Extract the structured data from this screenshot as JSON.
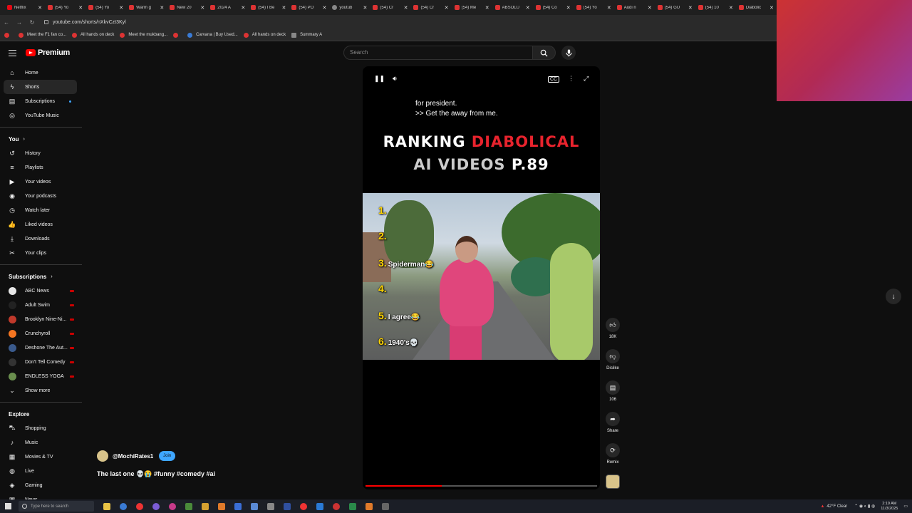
{
  "browser": {
    "tabs": [
      {
        "label": "Netflix",
        "fav": "n"
      },
      {
        "label": "(54) Yo",
        "fav": "r"
      },
      {
        "label": "(54) Yo",
        "fav": "r"
      },
      {
        "label": "Warm g",
        "fav": "r"
      },
      {
        "label": "New 20",
        "fav": "r"
      },
      {
        "label": "2024 A",
        "fav": "r"
      },
      {
        "label": "(54) I Be",
        "fav": "r"
      },
      {
        "label": "(54) PO",
        "fav": "r"
      },
      {
        "label": "youtub",
        "fav": "g"
      },
      {
        "label": "(54) Cr",
        "fav": "r"
      },
      {
        "label": "(54) Cr",
        "fav": "r"
      },
      {
        "label": "(54) Me",
        "fav": "r"
      },
      {
        "label": "ABSOLU",
        "fav": "r"
      },
      {
        "label": "(54) Co",
        "fav": "r"
      },
      {
        "label": "(54) Yo",
        "fav": "r"
      },
      {
        "label": "Audi n",
        "fav": "r"
      },
      {
        "label": "(54) GU",
        "fav": "r"
      },
      {
        "label": "(54) 10",
        "fav": "r"
      },
      {
        "label": "Diabolic",
        "fav": "r"
      }
    ],
    "url": "youtube.com/shorts/nXkvCzt3Kyl",
    "bookmarks": [
      {
        "label": "",
        "icon": "youtube-icon"
      },
      {
        "label": "Meet the F1 fan co...",
        "icon": "youtube-icon"
      },
      {
        "label": "All hands on deck",
        "icon": "youtube-icon"
      },
      {
        "label": "Meet the mukbang...",
        "icon": "youtube-icon"
      },
      {
        "label": "",
        "icon": "youtube-icon"
      },
      {
        "label": "Carvana | Buy Used...",
        "icon": "carvana-icon"
      },
      {
        "label": "All hands on deck",
        "icon": "youtube-icon"
      },
      {
        "label": "Summary A",
        "icon": "summary-icon"
      }
    ]
  },
  "header": {
    "logo_text": "Premium",
    "search_placeholder": "Search"
  },
  "sidebar": {
    "main": [
      {
        "label": "Home",
        "icon": "⌂",
        "name": "home"
      },
      {
        "label": "Shorts",
        "icon": "ϟ",
        "name": "shorts",
        "active": true
      },
      {
        "label": "Subscriptions",
        "icon": "▤",
        "name": "subscriptions",
        "dot": true
      },
      {
        "label": "YouTube Music",
        "icon": "◎",
        "name": "youtube-music"
      }
    ],
    "you_heading": "You",
    "you": [
      {
        "label": "History",
        "icon": "↺",
        "name": "history"
      },
      {
        "label": "Playlists",
        "icon": "≡",
        "name": "playlists"
      },
      {
        "label": "Your videos",
        "icon": "▶",
        "name": "your-videos"
      },
      {
        "label": "Your podcasts",
        "icon": "◉",
        "name": "your-podcasts"
      },
      {
        "label": "Watch later",
        "icon": "◷",
        "name": "watch-later"
      },
      {
        "label": "Liked videos",
        "icon": "👍",
        "name": "liked-videos"
      },
      {
        "label": "Downloads",
        "icon": "⤓",
        "name": "downloads"
      },
      {
        "label": "Your clips",
        "icon": "✂",
        "name": "your-clips"
      }
    ],
    "subs_heading": "Subscriptions",
    "subs": [
      {
        "label": "ABC News",
        "color": "#e6e6e6"
      },
      {
        "label": "Adult Swim",
        "color": "#222222"
      },
      {
        "label": "Brooklyn Nine-Ni...",
        "color": "#c0392b"
      },
      {
        "label": "Crunchyroll",
        "color": "#f47521"
      },
      {
        "label": "Deshone The Aut...",
        "color": "#3a5a8c"
      },
      {
        "label": "Don't Tell Comedy",
        "color": "#333333"
      },
      {
        "label": "ENDLESS YOGA",
        "color": "#6a8f4e"
      }
    ],
    "show_more": "Show more",
    "explore_heading": "Explore",
    "explore": [
      {
        "label": "Shopping",
        "icon": "⛍",
        "name": "shopping"
      },
      {
        "label": "Music",
        "icon": "♪",
        "name": "music"
      },
      {
        "label": "Movies & TV",
        "icon": "▦",
        "name": "movies-tv"
      },
      {
        "label": "Live",
        "icon": "◍",
        "name": "live"
      },
      {
        "label": "Gaming",
        "icon": "◈",
        "name": "gaming"
      },
      {
        "label": "News",
        "icon": "▣",
        "name": "news"
      }
    ]
  },
  "player": {
    "caption_line1": "for president.",
    "caption_line2": ">> Get the away from me.",
    "title_white1": "RANKING ",
    "title_red": "DIABOLICAL",
    "title_grey": "AI VIDEOS ",
    "title_white2": "P.89",
    "rankings": [
      {
        "num": "1.",
        "text": ""
      },
      {
        "num": "2.",
        "text": ""
      },
      {
        "num": "3.",
        "text": "Spiderman😂"
      },
      {
        "num": "4.",
        "text": ""
      },
      {
        "num": "5.",
        "text": "I agree😂"
      },
      {
        "num": "6.",
        "text": "1940's💀"
      }
    ],
    "progress_fraction": 0.33
  },
  "actions": {
    "likes": "18K",
    "dislike": "Dislike",
    "comments": "106",
    "share": "Share",
    "remix": "Remix"
  },
  "channel": {
    "handle": "@MochiRates1",
    "join": "Join",
    "video_title": "The last one 💀😭 #funny #comedy #ai"
  },
  "taskbar": {
    "search_placeholder": "Type here to search",
    "weather": "42°F Clear",
    "time": "2:19 AM",
    "date": "11/3/2025"
  }
}
